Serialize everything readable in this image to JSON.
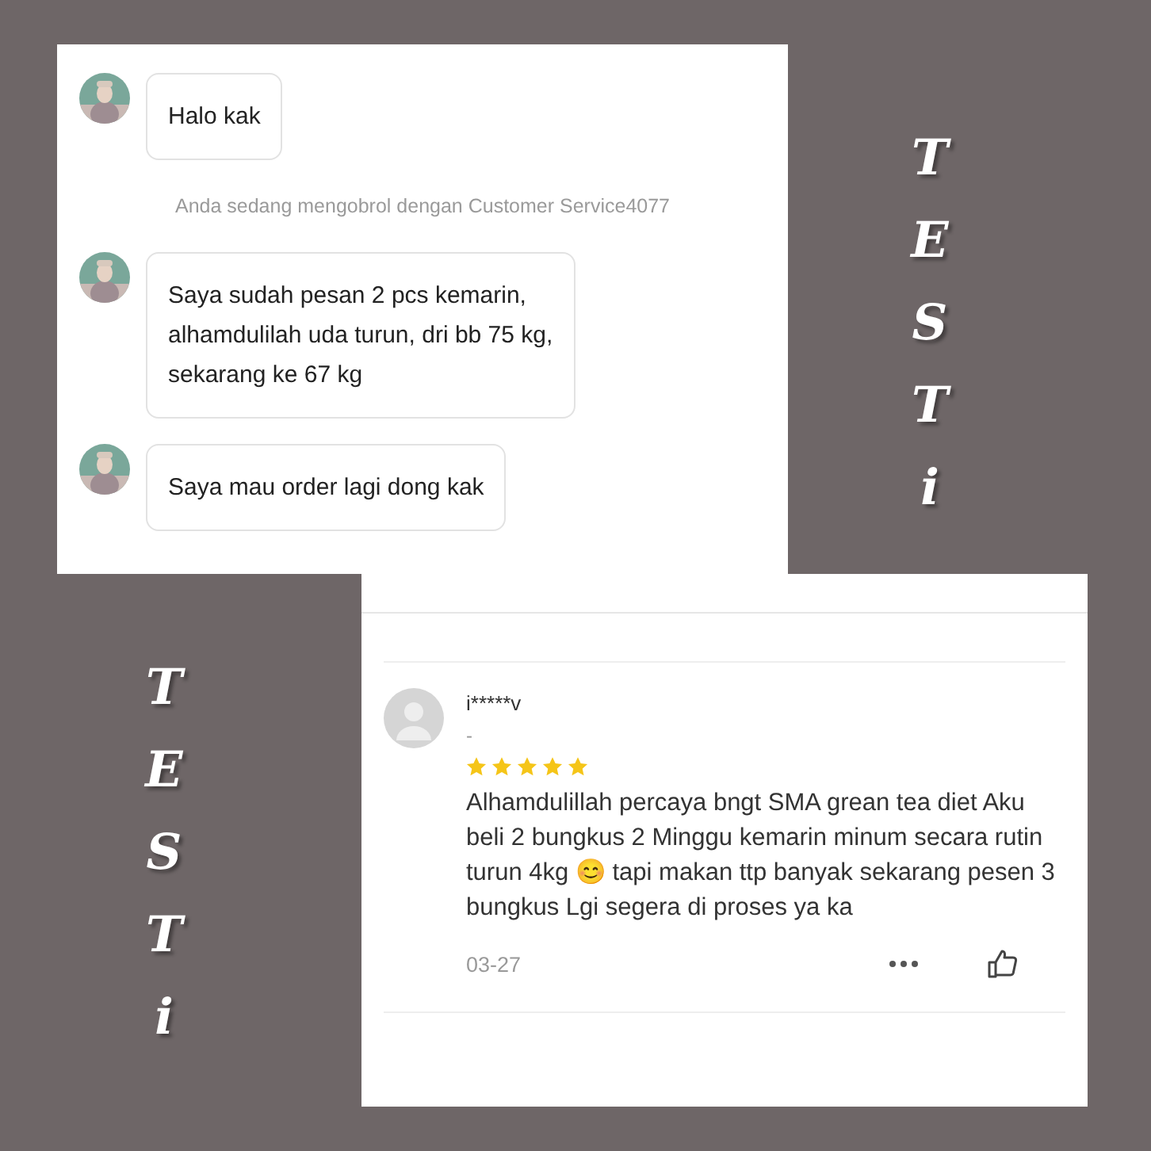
{
  "side_labels": [
    {
      "text": "TESTi"
    },
    {
      "text": "TESTi"
    }
  ],
  "chat": {
    "messages": [
      {
        "kind": "bubble",
        "text": "Halo kak"
      },
      {
        "kind": "notice",
        "text": "Anda sedang mengobrol dengan Customer Service4077"
      },
      {
        "kind": "bubble",
        "text": "Saya sudah pesan 2 pcs kemarin,\nalhamdulilah uda turun, dri bb 75 kg,\nsekarang ke 67 kg"
      },
      {
        "kind": "bubble",
        "text": "Saya mau order lagi dong kak"
      }
    ]
  },
  "review": {
    "user": "i*****v",
    "variant": "-",
    "stars": 5,
    "text": "Alhamdulillah percaya bngt SMA grean tea diet Aku beli 2 bungkus 2 Minggu kemarin minum secara rutin turun 4kg 😊 tapi makan ttp banyak sekarang pesen 3 bungkus Lgi segera di proses ya ka",
    "date": "03-27"
  }
}
